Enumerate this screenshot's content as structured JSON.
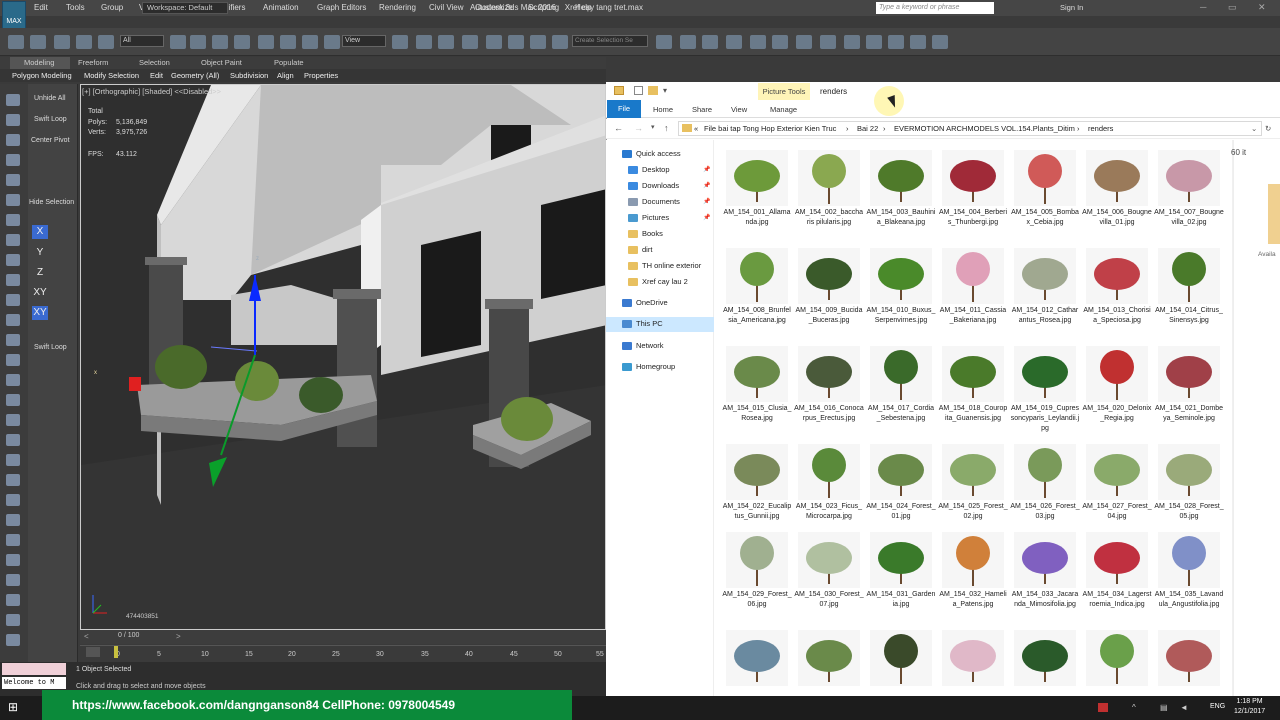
{
  "app": {
    "title": "Autodesk 3ds Max 2016",
    "file": "Xref cay tang tret.max",
    "logo": "MAX",
    "workspace": "Workspace: Default",
    "search_placeholder": "Type a keyword or phrase",
    "signin": "Sign In"
  },
  "menus": [
    "Edit",
    "Tools",
    "Group",
    "Views",
    "Create",
    "Modifiers",
    "Animation",
    "Graph Editors",
    "Rendering",
    "Civil View",
    "Customize",
    "Scripting",
    "Help"
  ],
  "toolbar": {
    "selection_filter": "All",
    "ref_coord": "View",
    "selection_set": "Create Selection Se"
  },
  "ribbon": {
    "tabs": [
      "Modeling",
      "Freeform",
      "Selection",
      "Object Paint",
      "Populate"
    ],
    "subtabs": [
      "Polygon Modeling",
      "Modify Selection",
      "Edit",
      "Geometry (All)",
      "Subdivision",
      "Align",
      "Properties"
    ]
  },
  "command_panel": {
    "unhide_all": "Unhide All",
    "swift_loop": "Swift Loop",
    "center_pivot": "Center Pivot",
    "hide_selection": "Hide Selection",
    "axes": [
      "X",
      "Y",
      "Z",
      "XY",
      "XY"
    ],
    "swift_loop_2": "Swift Loop"
  },
  "viewport": {
    "label": "[+] [Orthographic] [Shaded] <<Disabled>>",
    "total_label": "Total",
    "polys_label": "Polys:",
    "polys_value": "5,136,849",
    "verts_label": "Verts:",
    "verts_value": "3,975,726",
    "fps_label": "FPS:",
    "fps_value": "43.112",
    "coord_readout": "474403851",
    "gizmo_x": "x",
    "gizmo_z": "z"
  },
  "timeline": {
    "frame": "0 / 100",
    "ticks": [
      "0",
      "5",
      "10",
      "15",
      "20",
      "25",
      "30",
      "35",
      "40",
      "45",
      "50",
      "55"
    ]
  },
  "status": {
    "welcome": "Welcome to M",
    "object_selected": "1 Object Selected",
    "hint": "Click and drag to select and move objects"
  },
  "explorer": {
    "context_tab": "Picture Tools",
    "window_title": "renders",
    "tabs": [
      "File",
      "Home",
      "Share",
      "View",
      "Manage"
    ],
    "breadcrumbs": [
      "File bai tap Tong Hop Exterior Kien Truc",
      "Bai 22",
      "EVERMOTION ARCHMODELS VOL.154.Plants_Ditim",
      "renders"
    ],
    "nav": [
      {
        "label": "Quick access",
        "sub": false,
        "pin": false
      },
      {
        "label": "Desktop",
        "sub": true,
        "pin": true
      },
      {
        "label": "Downloads",
        "sub": true,
        "pin": true
      },
      {
        "label": "Documents",
        "sub": true,
        "pin": true
      },
      {
        "label": "Pictures",
        "sub": true,
        "pin": true
      },
      {
        "label": "Books",
        "sub": true,
        "pin": false
      },
      {
        "label": "dirt",
        "sub": true,
        "pin": false
      },
      {
        "label": "TH online exterior",
        "sub": true,
        "pin": false
      },
      {
        "label": "Xref cay lau 2",
        "sub": true,
        "pin": false
      },
      {
        "label": "OneDrive",
        "sub": false,
        "pin": false
      },
      {
        "label": "This PC",
        "sub": false,
        "pin": false
      },
      {
        "label": "Network",
        "sub": false,
        "pin": false
      },
      {
        "label": "Homegroup",
        "sub": false,
        "pin": false
      }
    ],
    "item_count": "60 it",
    "details_hint": "Availa",
    "files": [
      "AM_154_001_Allamanda.jpg",
      "AM_154_002_baccharis pilularis.jpg",
      "AM_154_003_Bauhinia_Blakeana.jpg",
      "AM_154_004_Berberis_Thunbergi.jpg",
      "AM_154_005_Bombax_Cebia.jpg",
      "AM_154_006_Bougnevilla_01.jpg",
      "AM_154_007_Bougnevilla_02.jpg",
      "AM_154_008_Brunfelsia_Americana.jpg",
      "AM_154_009_Bucida_Buceras.jpg",
      "AM_154_010_Buxus_Serpenvirnes.jpg",
      "AM_154_011_Cassia_Bakeriana.jpg",
      "AM_154_012_Catharantus_Rosea.jpg",
      "AM_154_013_Chorisia_Speciosa.jpg",
      "AM_154_014_Citrus_Sinensys.jpg",
      "AM_154_015_Clusia_Rosea.jpg",
      "AM_154_016_Conocarpus_Erectus.jpg",
      "AM_154_017_Cordia_Sebestena.jpg",
      "AM_154_018_Couropita_Guanensis.jpg",
      "AM_154_019_Cupressoncyparis_Leylandii.jpg",
      "AM_154_020_Delonix_Regia.jpg",
      "AM_154_021_Dombeya_Seminole.jpg",
      "AM_154_022_Eucaliptus_Gunnii.jpg",
      "AM_154_023_Ficus_Microcarpa.jpg",
      "AM_154_024_Forest_01.jpg",
      "AM_154_025_Forest_02.jpg",
      "AM_154_026_Forest_03.jpg",
      "AM_154_027_Forest_04.jpg",
      "AM_154_028_Forest_05.jpg",
      "AM_154_029_Forest_06.jpg",
      "AM_154_030_Forest_07.jpg",
      "AM_154_031_Gardenia.jpg",
      "AM_154_032_Hamelia_Patens.jpg",
      "AM_154_033_Jacaranda_Mimosifolia.jpg",
      "AM_154_034_Lagerstroemia_Indica.jpg",
      "AM_154_035_Lavandula_Angustifolia.jpg",
      "",
      "",
      "",
      "",
      "",
      "",
      ""
    ],
    "foliage_colors": [
      "#6d9a3a",
      "#8aa850",
      "#4f7a2a",
      "#a02a38",
      "#d05a58",
      "#9a7a5a",
      "#c898a8",
      "#6a9a40",
      "#3a5a2a",
      "#4a8a2a",
      "#e0a0b8",
      "#a0a890",
      "#c04048",
      "#4a7a2a",
      "#6a8a4a",
      "#4a5a3a",
      "#3a6a2a",
      "#4a7a2a",
      "#2a6a2a",
      "#c03030",
      "#a04048",
      "#7a8a5a",
      "#5a8a3a",
      "#6a8a4a",
      "#8aaa6a",
      "#7a9a5a",
      "#8aaa6a",
      "#9aaa7a",
      "#a0b090",
      "#b0c0a0",
      "#3a7a2a",
      "#d0803a",
      "#8060c0",
      "#c03040",
      "#8090c8",
      "#6a8aa0",
      "#6a8a4a",
      "#3a4a2a",
      "#e0b8c8",
      "#2a5a2a",
      "#6aa04a",
      "#b05a5a"
    ]
  },
  "taskbar": {
    "banner": "https://www.facebook.com/dangnganson84  CellPhone: 0978004549",
    "time": "1:18 PM",
    "date": "12/1/2017",
    "lang": "ENG"
  }
}
